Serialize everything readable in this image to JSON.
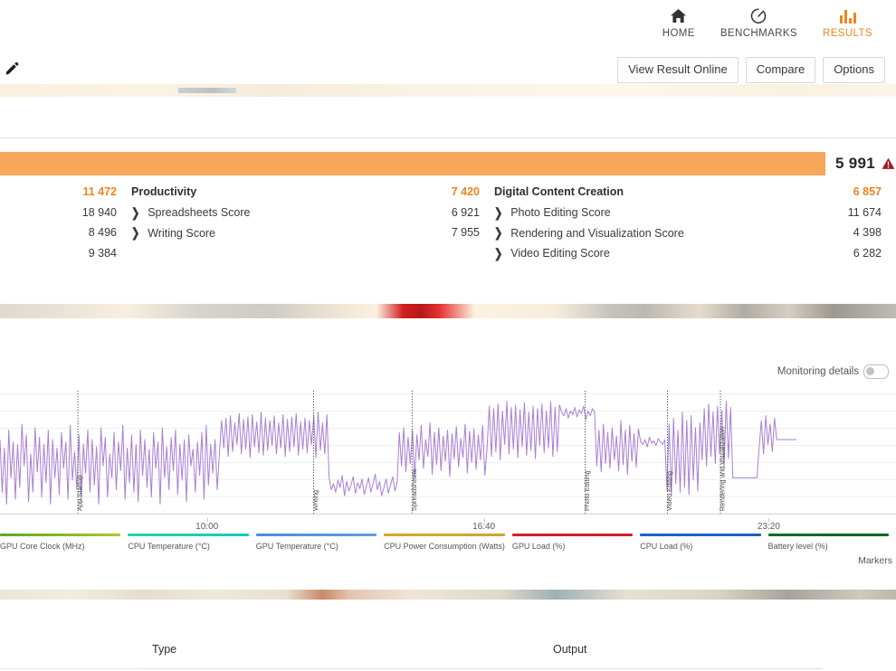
{
  "nav": {
    "items": [
      {
        "label": "HOME",
        "icon": "home-icon",
        "active": false
      },
      {
        "label": "BENCHMARKS",
        "icon": "speedometer-icon",
        "active": false
      },
      {
        "label": "RESULTS",
        "icon": "bar-chart-icon",
        "active": true
      }
    ]
  },
  "toolbar": {
    "view_result_online": "View Result Online",
    "compare": "Compare",
    "options": "Options",
    "edit_icon": "pencil-icon"
  },
  "overall": {
    "total_score": "5 991",
    "warning_icon": "warning-triangle-icon",
    "bar_color": "#f8a65a",
    "accent_color": "#ef8421"
  },
  "score_groups": [
    {
      "header": {
        "col_a": "11 472",
        "label_a": "Productivity",
        "col_b": "7 420",
        "label_b": "Digital Content Creation",
        "col_c": "6 857"
      },
      "rows": [
        {
          "col_a": "18 940",
          "label_a": "Spreadsheets Score",
          "has_chevron_a": true,
          "col_b": "6 921",
          "label_b": "Photo Editing Score",
          "has_chevron_b": true,
          "col_c": "11 674"
        },
        {
          "col_a": "8 496",
          "label_a": "Writing Score",
          "has_chevron_a": true,
          "col_b": "7 955",
          "label_b": "Rendering and Visualization Score",
          "has_chevron_b": true,
          "col_c": "4 398"
        },
        {
          "col_a": "9 384",
          "label_a": "",
          "has_chevron_a": false,
          "col_b": "",
          "label_b": "Video Editing Score",
          "has_chevron_b": true,
          "col_c": "6 282"
        }
      ]
    }
  ],
  "monitoring": {
    "details_label": "Monitoring details",
    "markers_label": "Markers",
    "toggle_state": "off"
  },
  "chart_data": {
    "type": "line",
    "title": "",
    "xlabel": "",
    "ylabel": "",
    "x_ticks": [
      {
        "label": "10:00",
        "pos_pct": 23.1
      },
      {
        "label": "16:40",
        "pos_pct": 54.0
      },
      {
        "label": "23:20",
        "pos_pct": 85.8
      }
    ],
    "markers": [
      {
        "label": "App Startup",
        "pos_pct": 8.7
      },
      {
        "label": "Writing",
        "pos_pct": 35.0
      },
      {
        "label": "Spreadsheets",
        "pos_pct": 46.0
      },
      {
        "label": "Photo Editing",
        "pos_pct": 65.3
      },
      {
        "label": "Video Editing",
        "pos_pct": 74.5
      },
      {
        "label": "Rendering and Visualization",
        "pos_pct": 80.4
      }
    ],
    "series": [
      {
        "name": "GPU Core Clock (MHz)",
        "color": "#a97fd6",
        "values": [
          62,
          18,
          55,
          8,
          70,
          30,
          60,
          12,
          58,
          22,
          75,
          40,
          66,
          10,
          50,
          18,
          72,
          35,
          64,
          14,
          58,
          26,
          70,
          8,
          62,
          30,
          55,
          16,
          68,
          38,
          60,
          12,
          74,
          28,
          52,
          20,
          66,
          10,
          58,
          34,
          70,
          18,
          62,
          24,
          56,
          8,
          72,
          40,
          64,
          14,
          50,
          30,
          68,
          20,
          60,
          36,
          74,
          12,
          55,
          26,
          66,
          18,
          58,
          10,
          70,
          32,
          62,
          22,
          54,
          14,
          68,
          38,
          60,
          8,
          72,
          30,
          56,
          20,
          64,
          36,
          70,
          16,
          58,
          28,
          62,
          10,
          66,
          40,
          54,
          18,
          60,
          32,
          68,
          12,
          74,
          24,
          58,
          34,
          62,
          20,
          50,
          78,
          55,
          80,
          48,
          82,
          52,
          76,
          58,
          84,
          50,
          79,
          54,
          81,
          47,
          83,
          56,
          77,
          51,
          85,
          49,
          80,
          53,
          78,
          57,
          82,
          50,
          76,
          55,
          83,
          48,
          79,
          52,
          81,
          56,
          84,
          49,
          77,
          54,
          80,
          51,
          78,
          58,
          82,
          47,
          85,
          53,
          76,
          50,
          83,
          30,
          20,
          25,
          18,
          28,
          22,
          32,
          15,
          27,
          19,
          24,
          31,
          17,
          26,
          21,
          29,
          16,
          23,
          30,
          18,
          25,
          33,
          20,
          27,
          15,
          22,
          29,
          17,
          24,
          31,
          19,
          26,
          68,
          40,
          72,
          35,
          64,
          42,
          70,
          30,
          66,
          45,
          74,
          38,
          62,
          48,
          76,
          33,
          68,
          41,
          72,
          36,
          65,
          44,
          70,
          31,
          67,
          46,
          73,
          39,
          63,
          47,
          75,
          34,
          69,
          43,
          71,
          37,
          66,
          45,
          74,
          32,
          55,
          90,
          48,
          88,
          52,
          92,
          45,
          86,
          58,
          94,
          50,
          89,
          54,
          91,
          47,
          87,
          56,
          93,
          49,
          85,
          53,
          90,
          46,
          88,
          57,
          92,
          51,
          86,
          55,
          94,
          48,
          89,
          52,
          91,
          85,
          82,
          88,
          80,
          86,
          83,
          89,
          81,
          87,
          84,
          90,
          79,
          86,
          82,
          88,
          85,
          40,
          70,
          35,
          75,
          42,
          68,
          38,
          72,
          45,
          65,
          36,
          78,
          41,
          70,
          33,
          74,
          44,
          67,
          39,
          71,
          60,
          58,
          62,
          56,
          64,
          59,
          61,
          57,
          63,
          60,
          58,
          62,
          20,
          75,
          15,
          80,
          25,
          70,
          18,
          85,
          22,
          78,
          16,
          82,
          28,
          72,
          19,
          76,
          45,
          88,
          40,
          92,
          48,
          85,
          42,
          90,
          50,
          86,
          38,
          94,
          46,
          89,
          30,
          30,
          30,
          30,
          30,
          30,
          30,
          30,
          30,
          30,
          30,
          30,
          55,
          78,
          50,
          82,
          58,
          75,
          52,
          80,
          62,
          62,
          62,
          62,
          62,
          62,
          62,
          62,
          62,
          62
        ]
      }
    ],
    "legend": [
      {
        "label": "GPU Core Clock (MHz)",
        "color_start": "#5aa825",
        "color_end": "#a8c92a"
      },
      {
        "label": "CPU Temperature (°C)",
        "color_start": "#1ed6a8",
        "color_end": "#18c9b6"
      },
      {
        "label": "GPU Temperature (°C)",
        "color_start": "#4a8fd8",
        "color_end": "#5f9de0"
      },
      {
        "label": "CPU Power Consumption (Watts)",
        "color_start": "#d4a72c",
        "color_end": "#cfa52c"
      },
      {
        "label": "GPU Load (%)",
        "color_start": "#d32028",
        "color_end": "#cf1f26"
      },
      {
        "label": "CPU Load (%)",
        "color_start": "#1b64c4",
        "color_end": "#1a62c0"
      },
      {
        "label": "Battery level (%)",
        "color_start": "#0f6b2a",
        "color_end": "#0e6828"
      }
    ],
    "grid": true,
    "legend_position": "bottom"
  },
  "bottom_table": {
    "columns": [
      "Type",
      "Output"
    ]
  }
}
